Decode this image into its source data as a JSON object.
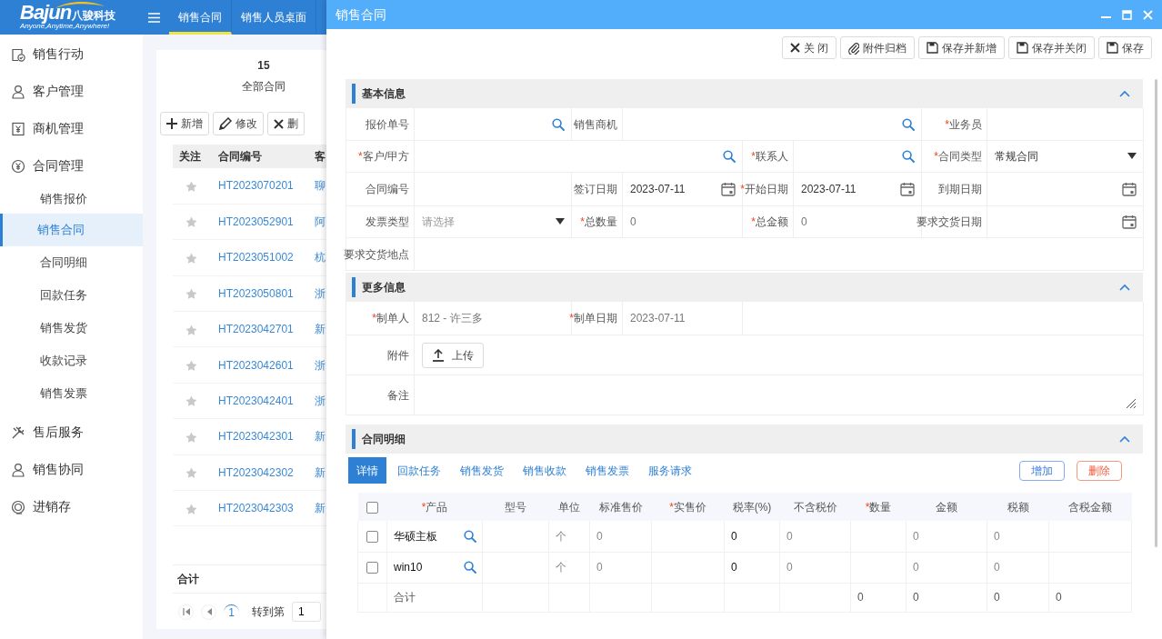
{
  "app_header": {
    "logo": {
      "name": "Bajun",
      "name_cn": "八骏科技",
      "tagline": "Anyone,Anytime,Anywhere!"
    },
    "tabs": [
      {
        "label": "销售合同",
        "selected": true
      },
      {
        "label": "销售人员桌面",
        "selected": false
      }
    ]
  },
  "sidebar": {
    "items": [
      {
        "label": "销售行动",
        "selected": false
      },
      {
        "label": "客户管理",
        "selected": false
      },
      {
        "label": "商机管理",
        "selected": false
      },
      {
        "label": "合同管理",
        "selected": false,
        "children": [
          {
            "label": "销售报价",
            "selected": false
          },
          {
            "label": "销售合同",
            "selected": true
          },
          {
            "label": "合同明细",
            "selected": false
          },
          {
            "label": "回款任务",
            "selected": false
          },
          {
            "label": "销售发货",
            "selected": false
          },
          {
            "label": "收款记录",
            "selected": false
          },
          {
            "label": "销售发票",
            "selected": false
          }
        ]
      },
      {
        "label": "售后服务",
        "selected": false
      },
      {
        "label": "销售协同",
        "selected": false
      },
      {
        "label": "进销存",
        "selected": false
      }
    ]
  },
  "list_panel": {
    "count": "15",
    "count_label": "全部合同",
    "buttons": [
      "新增",
      "修改",
      "删"
    ],
    "table": {
      "columns": [
        "关注",
        "合同编号",
        "客"
      ],
      "rows": [
        {
          "starred": false,
          "contract_no": "HT2023070201",
          "customer": "聊"
        },
        {
          "starred": false,
          "contract_no": "HT2023052901",
          "customer": "阿"
        },
        {
          "starred": false,
          "contract_no": "HT2023051002",
          "customer": "杭"
        },
        {
          "starred": false,
          "contract_no": "HT2023050801",
          "customer": "浙"
        },
        {
          "starred": false,
          "contract_no": "HT2023042701",
          "customer": "新"
        },
        {
          "starred": false,
          "contract_no": "HT2023042601",
          "customer": "浙"
        },
        {
          "starred": false,
          "contract_no": "HT2023042401",
          "customer": "浙"
        },
        {
          "starred": false,
          "contract_no": "HT2023042301",
          "customer": "新"
        },
        {
          "starred": false,
          "contract_no": "HT2023042302",
          "customer": "新"
        },
        {
          "starred": false,
          "contract_no": "HT2023042303",
          "customer": "新"
        }
      ]
    },
    "total_label": "合计",
    "pager": {
      "pages": [
        {
          "label": "1",
          "selected": true
        }
      ],
      "goto_label": "转到第",
      "goto_value": "1"
    }
  },
  "modal": {
    "title": "销售合同",
    "toolbar": [
      "关 闭",
      "附件归档",
      "保存并新增",
      "保存并关闭",
      "保存"
    ],
    "sections": [
      {
        "title": "基本信息",
        "expanded": true,
        "kind": "form",
        "fields": [
          {
            "label": "报价单号",
            "kind": "search"
          },
          {
            "label": "销售商机",
            "kind": "search"
          },
          {
            "label": "业务员",
            "mark": "*",
            "kind": "text"
          },
          {
            "label": "客户/甲方",
            "mark": "*",
            "kind": "search"
          },
          {
            "label": "联系人",
            "mark": "*",
            "kind": "search"
          },
          {
            "label": "合同类型",
            "mark": "*",
            "kind": "select",
            "value": "常规合同"
          },
          {
            "label": "合同编号",
            "kind": "text"
          },
          {
            "label": "签订日期",
            "kind": "date",
            "value": "2023-07-11",
            "readonly": false
          },
          {
            "label": "开始日期",
            "mark": "*",
            "kind": "date",
            "value": "2023-07-11",
            "readonly": false
          },
          {
            "label": "到期日期",
            "kind": "date"
          },
          {
            "label": "发票类型",
            "kind": "select",
            "placeholder": "请选择"
          },
          {
            "label": "总数量",
            "mark": "*",
            "kind": "text",
            "value": "0",
            "readonly": true
          },
          {
            "label": "总金额",
            "mark": "*",
            "kind": "text",
            "value": "0",
            "readonly": true
          },
          {
            "label": "要求交货日期",
            "kind": "date"
          },
          {
            "label": "要求交货地点",
            "kind": "text"
          }
        ]
      },
      {
        "title": "更多信息",
        "expanded": true,
        "kind": "form",
        "fields": [
          {
            "label": "制单人",
            "mark": "*",
            "kind": "text",
            "value": "812 - 许三多",
            "readonly": true
          },
          {
            "label": "制单日期",
            "mark": "*",
            "kind": "text",
            "value": "2023-07-11",
            "readonly": true
          },
          {
            "label": "附件",
            "kind": "upload",
            "button_label": "上传"
          },
          {
            "label": "备注",
            "kind": "textarea"
          }
        ]
      },
      {
        "title": "合同明细",
        "expanded": true,
        "kind": "detail",
        "tabs": [
          {
            "label": "详情",
            "selected": true
          },
          {
            "label": "回款任务",
            "selected": false
          },
          {
            "label": "销售发货",
            "selected": false
          },
          {
            "label": "销售收款",
            "selected": false
          },
          {
            "label": "销售发票",
            "selected": false
          },
          {
            "label": "服务请求",
            "selected": false
          }
        ],
        "buttons": [
          {
            "label": "增加",
            "kind": "primary"
          },
          {
            "label": "删除",
            "kind": "danger"
          }
        ],
        "table": {
          "all_checked": false,
          "columns": [
            {
              "label": "产品",
              "mark": "*",
              "kind": "input"
            },
            {
              "label": "型号",
              "kind": "text"
            },
            {
              "label": "单位",
              "kind": "text"
            },
            {
              "label": "标准售价",
              "kind": "text"
            },
            {
              "label": "实售价",
              "mark": "*",
              "kind": "text"
            },
            {
              "label": "税率(%)",
              "kind": "input"
            },
            {
              "label": "不含税价",
              "kind": "text"
            },
            {
              "label": "数量",
              "mark": "*",
              "kind": "text"
            },
            {
              "label": "金额",
              "kind": "text"
            },
            {
              "label": "税额",
              "kind": "text"
            },
            {
              "label": "含税金额",
              "kind": "text"
            }
          ],
          "rows": [
            {
              "checked": false,
              "cells": [
                "华硕主板",
                null,
                "个",
                "0",
                null,
                "0",
                "0",
                null,
                "0",
                "0",
                null
              ]
            },
            {
              "checked": false,
              "cells": [
                "win10",
                null,
                "个",
                "0",
                null,
                "0",
                "0",
                null,
                "0",
                "0",
                null
              ]
            }
          ],
          "total_row": {
            "cells": [
              "合计",
              null,
              null,
              null,
              null,
              null,
              null,
              "0",
              "0",
              "0",
              "0"
            ]
          }
        }
      }
    ]
  }
}
